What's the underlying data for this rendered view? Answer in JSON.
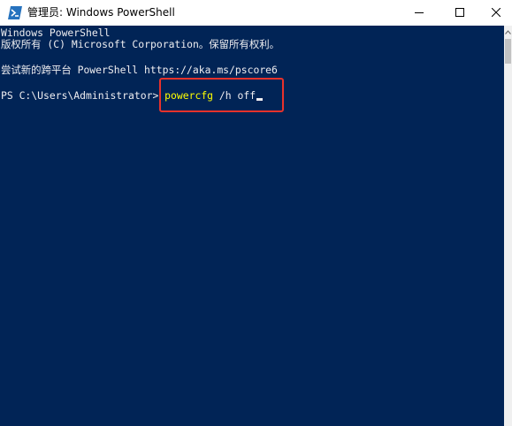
{
  "window": {
    "title": "管理员: Windows PowerShell",
    "app_icon": "powershell-icon",
    "controls": [
      "minimize-icon",
      "maximize-icon",
      "close-icon"
    ]
  },
  "console": {
    "lines": [
      "Windows PowerShell",
      "版权所有 (C) Microsoft Corporation。保留所有权利。",
      "尝试新的跨平台 PowerShell https://aka.ms/pscore6"
    ],
    "prompt": "PS C:\\Users\\Administrator> ",
    "command": "powercfg",
    "arguments": " /h off"
  },
  "colors": {
    "console_background": "#012456",
    "console_text": "#eeedf0",
    "command_text": "#ffff00",
    "highlight_border": "#e8322b"
  }
}
